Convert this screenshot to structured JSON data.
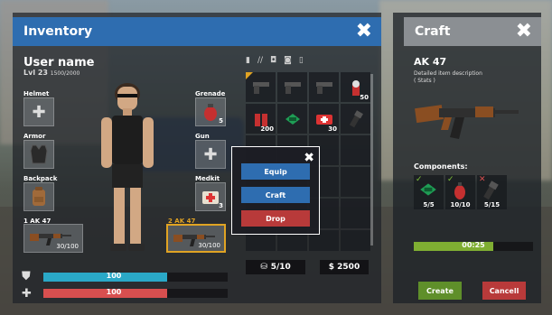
{
  "inventory": {
    "title": "Inventory",
    "user": {
      "name": "User name",
      "level": "Lvl 23",
      "xp": "1500/2000"
    },
    "equipment": {
      "helmet": "Helmet",
      "armor": "Armor",
      "backpack": "Backpack",
      "grenade": "Grenade",
      "grenade_count": "5",
      "gun": "Gun",
      "medkit": "Medkit",
      "medkit_count": "3"
    },
    "weapons": [
      {
        "label": "1 AK 47",
        "ammo": "30/100"
      },
      {
        "label": "2 AK 47",
        "ammo": "30/100"
      }
    ],
    "stats": {
      "armor_value": "100",
      "health_value": "100",
      "armor_fraction": 0.67,
      "health_fraction": 0.67
    },
    "grid_items": [
      {
        "icon": "pistol-icon",
        "qty": ""
      },
      {
        "icon": "pistol-icon",
        "qty": ""
      },
      {
        "icon": "pistol-icon",
        "qty": ""
      },
      {
        "icon": "ammo-icon",
        "qty": "50"
      },
      {
        "icon": "shells-icon",
        "qty": "200"
      },
      {
        "icon": "green-ammo-icon",
        "qty": ""
      },
      {
        "icon": "medkit-icon",
        "qty": "30"
      },
      {
        "icon": "flashlight-icon",
        "qty": ""
      }
    ],
    "capacity": "5/10",
    "money": "$ 2500"
  },
  "popup": {
    "equip": "Equip",
    "craft": "Craft",
    "drop": "Drop"
  },
  "craft": {
    "title": "Craft",
    "item_name": "AK 47",
    "description": "Detailed item description",
    "stats": "( Stats )",
    "components_label": "Components:",
    "components": [
      {
        "icon": "green-ammo-icon",
        "qty": "5/5",
        "status": "✓"
      },
      {
        "icon": "extinguisher-icon",
        "qty": "10/10",
        "status": "✓"
      },
      {
        "icon": "flashlight-icon",
        "qty": "5/15",
        "status": "✕"
      }
    ],
    "timer": "00:25",
    "timer_fraction": 0.67,
    "create": "Create",
    "cancel": "Cancell"
  },
  "colors": {
    "inventory_title": "#2e6db0",
    "craft_title": "#8b8f93",
    "armor_bar": "#2aa8c7",
    "health_bar": "#d84f4f",
    "equip_button": "#2e6db0",
    "drop_button": "#b83a3a",
    "create_button": "#5f8f2a",
    "cancel_button": "#b83a3a",
    "selected_slot": "#e0a323"
  }
}
